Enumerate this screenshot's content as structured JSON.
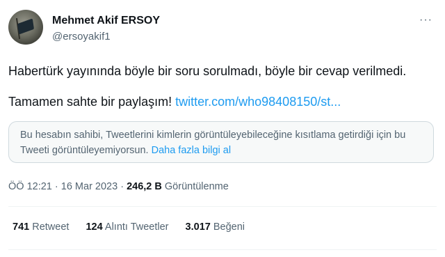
{
  "author": {
    "name": "Mehmet Akif ERSOY",
    "handle": "@ersoyakif1"
  },
  "more_icon": "more-dots-icon",
  "tweet": {
    "line1": "Habertürk yayınında böyle bir soru sorulmadı, böyle bir cevap verilmedi.",
    "line2_text": "Tamamen sahte bir paylaşım! ",
    "line2_link": "twitter.com/who98408150/st..."
  },
  "withheld": {
    "text": "Bu hesabın sahibi, Tweetlerini kimlerin görüntüleyebileceğine kısıtlama getirdiği için bu Tweeti görüntüleyemiyorsun. ",
    "link": "Daha fazla bilgi al"
  },
  "meta": {
    "time": "ÖÖ 12:21",
    "sep1": " · ",
    "date": "16 Mar 2023",
    "sep2": " · ",
    "views": "246,2 B",
    "views_label": " Görüntülenme"
  },
  "stats": {
    "retweets": "741",
    "retweets_label": " Retweet",
    "quotes": "124",
    "quotes_label": " Alıntı Tweetler",
    "likes": "3.017",
    "likes_label": " Beğeni"
  },
  "colors": {
    "accent": "#1d9bf0",
    "text": "#0f1419",
    "secondary": "#536471"
  }
}
